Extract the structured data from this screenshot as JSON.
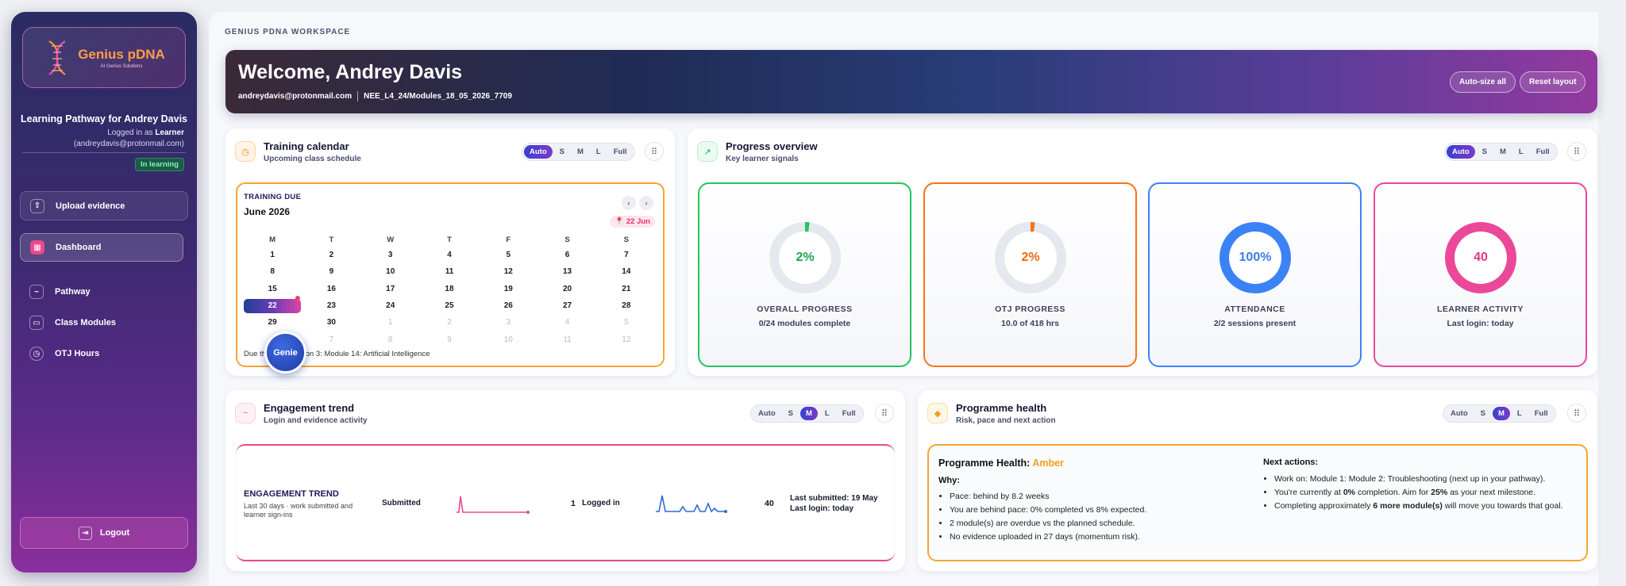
{
  "sidebar": {
    "logo_title": "Genius pDNA",
    "logo_sub": "AI Genius Solutions",
    "pathway_title": "Learning Pathway for Andrey Davis",
    "logged_in_prefix": "Logged in as",
    "role": "Learner",
    "email_paren": "(andreydavis@protonmail.com)",
    "status_badge": "In learning",
    "upload_label": "Upload evidence",
    "nav": [
      {
        "label": "Dashboard",
        "active": true
      },
      {
        "label": "Pathway"
      },
      {
        "label": "Class Modules"
      },
      {
        "label": "OTJ Hours"
      }
    ],
    "logout_label": "Logout"
  },
  "workspace_label": "GENIUS PDNA WORKSPACE",
  "hero": {
    "title": "Welcome, Andrey Davis",
    "email": "andreydavis@protonmail.com",
    "course_code": "NEE_L4_24/Modules_18_05_2026_7709",
    "autosize_label": "Auto-size all",
    "reset_label": "Reset layout"
  },
  "size_options": [
    "Auto",
    "S",
    "M",
    "L",
    "Full"
  ],
  "calendar_card": {
    "title": "Training calendar",
    "subtitle": "Upcoming class schedule",
    "active_size": "Auto",
    "section_label": "TRAINING DUE",
    "month": "June 2026",
    "pin_date": "22 Jun",
    "days_of_week": [
      "M",
      "T",
      "W",
      "T",
      "F",
      "S",
      "S"
    ],
    "days": [
      [
        "1",
        "2",
        "3",
        "4",
        "5",
        "6",
        "7"
      ],
      [
        "8",
        "9",
        "10",
        "11",
        "12",
        "13",
        "14"
      ],
      [
        "15",
        "16",
        "17",
        "18",
        "19",
        "20",
        "21"
      ],
      [
        "22",
        "23",
        "24",
        "25",
        "26",
        "27",
        "28"
      ],
      [
        "29",
        "30",
        "1",
        "2",
        "3",
        "4",
        "5"
      ],
      [
        "6",
        "7",
        "8",
        "9",
        "10",
        "11",
        "12"
      ]
    ],
    "today": "22",
    "due_text": "Due th      Jun · Session 3: Module 14: Artificial Intelligence",
    "genie_label": "Genie"
  },
  "progress_card": {
    "title": "Progress overview",
    "subtitle": "Key learner signals",
    "active_size": "Auto",
    "stats": [
      {
        "label": "OVERALL PROGRESS",
        "value": "2%",
        "detail": "0/24 modules complete",
        "percent": 2,
        "color": "#22c55e",
        "text_color": "#1fa34e"
      },
      {
        "label": "OTJ PROGRESS",
        "value": "2%",
        "detail": "10.0 of 418 hrs",
        "percent": 2,
        "color": "#f97316",
        "text_color": "#ea6a10"
      },
      {
        "label": "ATTENDANCE",
        "value": "100%",
        "detail": "2/2 sessions present",
        "percent": 100,
        "color": "#3b82f6",
        "text_color": "#3b7de6"
      },
      {
        "label": "LEARNER ACTIVITY",
        "value": "40",
        "detail": "Last login: today",
        "percent": 100,
        "color": "#ec4899",
        "text_color": "#e03a86"
      }
    ]
  },
  "engagement_card": {
    "title": "Engagement trend",
    "subtitle": "Login and evidence activity",
    "active_size": "M",
    "box_title": "ENGAGEMENT TREND",
    "box_sub": "Last 30 days · work submitted and learner sign-ins",
    "submitted_label": "Submitted",
    "submitted_count": "1",
    "logged_label": "Logged in",
    "logged_count": "40",
    "last_submitted": "Last submitted: 19 May",
    "last_login": "Last login: today"
  },
  "health_card": {
    "title": "Programme health",
    "subtitle": "Risk, pace and next action",
    "active_size": "M",
    "health_prefix": "Programme Health:",
    "health_value": "Amber",
    "why_label": "Why:",
    "why": [
      "Pace: behind by 8.2 weeks",
      "You are behind pace: 0% completed vs 8% expected.",
      "2 module(s) are overdue vs the planned schedule.",
      "No evidence uploaded in 27 days (momentum risk)."
    ],
    "next_label": "Next actions:",
    "next": {
      "work_on": "Work on: Module 1: Module 2: Troubleshooting (next up in your pathway).",
      "currently_a": "You're currently at ",
      "currently_b": "0%",
      "currently_c": " completion. Aim for ",
      "currently_d": "25%",
      "currently_e": " as your next milestone.",
      "completing_a": "Completing approximately ",
      "completing_b": "6 more module(s)",
      "completing_c": " will move you towards that goal."
    }
  }
}
